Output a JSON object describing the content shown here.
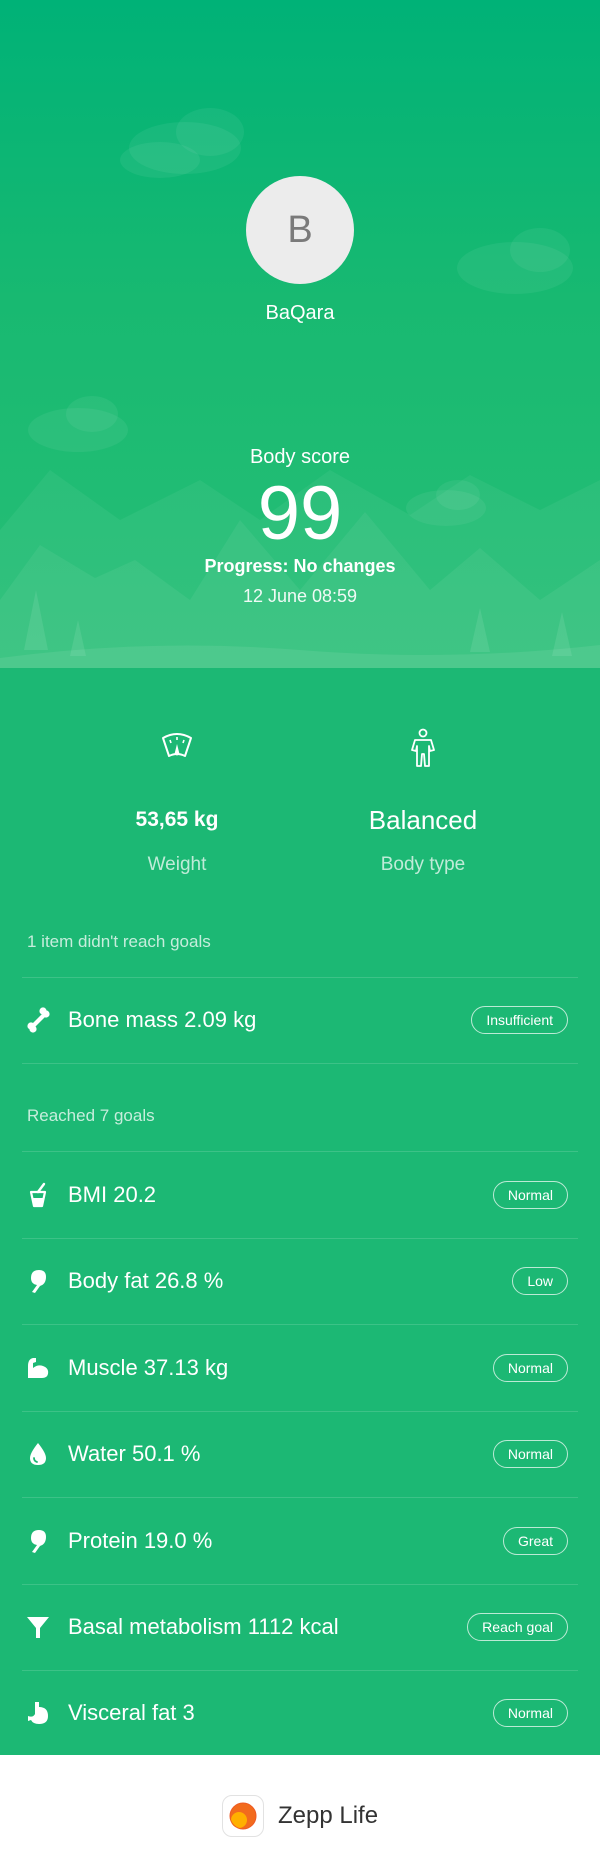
{
  "profile": {
    "avatar_initial": "B",
    "name": "BaQara"
  },
  "score": {
    "label": "Body score",
    "value": "99",
    "progress": "Progress: No changes",
    "timestamp": "12 June 08:59"
  },
  "stats": {
    "weight": {
      "value": "53,65 kg",
      "label": "Weight",
      "icon": "scale-icon"
    },
    "body_type": {
      "value": "Balanced",
      "label": "Body type",
      "icon": "person-icon"
    }
  },
  "unreached": {
    "title": "1 item didn't reach goals",
    "items": [
      {
        "label": "Bone mass 2.09 kg",
        "badge": "Insufficient",
        "icon": "bone-icon"
      }
    ]
  },
  "reached": {
    "title": "Reached 7 goals",
    "items": [
      {
        "label": "BMI 20.2",
        "badge": "Normal",
        "icon": "bmi-icon"
      },
      {
        "label": "Body fat 26.8 %",
        "badge": "Low",
        "icon": "body-fat-icon"
      },
      {
        "label": "Muscle 37.13 kg",
        "badge": "Normal",
        "icon": "muscle-icon"
      },
      {
        "label": "Water 50.1 %",
        "badge": "Normal",
        "icon": "water-drop-icon"
      },
      {
        "label": "Protein 19.0 %",
        "badge": "Great",
        "icon": "protein-icon"
      },
      {
        "label": "Basal metabolism 1112 kcal",
        "badge": "Reach goal",
        "icon": "funnel-icon"
      },
      {
        "label": "Visceral fat 3",
        "badge": "Normal",
        "icon": "stomach-icon"
      }
    ]
  },
  "footer": {
    "brand": "Zepp Life",
    "icon": "zepp-life-logo"
  },
  "colors": {
    "primary_green": "#1cb874",
    "header_green": "#00b277",
    "brand_orange": "#f26b1d"
  }
}
